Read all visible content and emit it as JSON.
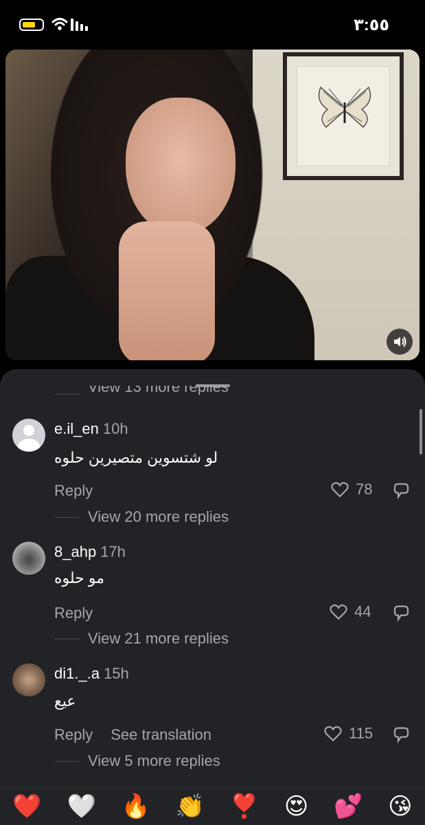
{
  "status": {
    "time": "٣:٥٥"
  },
  "comments": {
    "top_view_more": "View 13 more replies",
    "items": [
      {
        "username": "e.il_en",
        "time": "10h",
        "text": "لو شتسوين متصيرين حلوه",
        "reply": "Reply",
        "likes": "78",
        "view_more": "View 20 more replies"
      },
      {
        "username": "8_ahp",
        "time": "17h",
        "text": "مو حلوه",
        "reply": "Reply",
        "likes": "44",
        "view_more": "View 21 more replies"
      },
      {
        "username": "di1._.a",
        "time": "15h",
        "text": "عيع",
        "reply": "Reply",
        "see_translation": "See translation",
        "likes": "115",
        "view_more": "View 5 more replies"
      }
    ]
  },
  "emoji_bar": [
    "❤️",
    "🤍",
    "🔥",
    "👏",
    "❣️",
    "😍",
    "💕",
    "😘"
  ],
  "colors": {
    "sheet_bg": "#222327",
    "muted_text": "#a3a6ad",
    "battery": "#ffd60a"
  }
}
